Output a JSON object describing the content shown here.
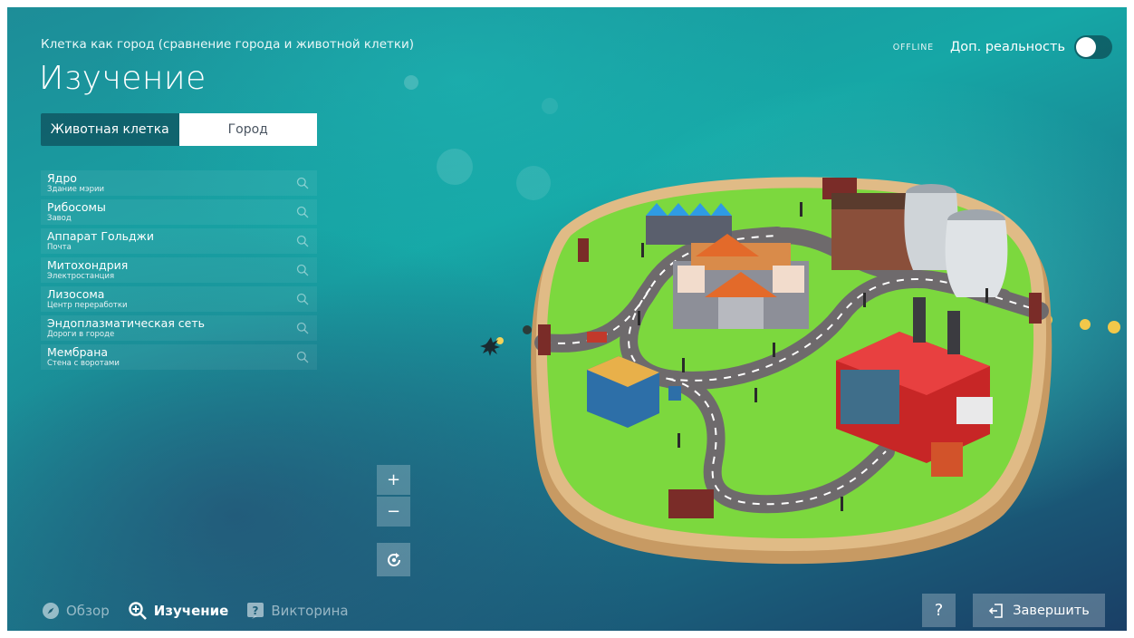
{
  "header": {
    "subtitle": "Клетка как город (сравнение города и животной клетки)",
    "title": "Изучение"
  },
  "ar": {
    "status": "OFFLINE",
    "label": "Доп. реальность",
    "enabled": false
  },
  "segmented": {
    "options": [
      "Животная клетка",
      "Город"
    ],
    "selected": "Город"
  },
  "organelles": [
    {
      "name": "Ядро",
      "analog": "Здание мэрии"
    },
    {
      "name": "Рибосомы",
      "analog": "Завод"
    },
    {
      "name": "Аппарат Гольджи",
      "analog": "Почта"
    },
    {
      "name": "Митохондрия",
      "analog": "Электростанция"
    },
    {
      "name": "Лизосома",
      "analog": "Центр переработки"
    },
    {
      "name": "Эндоплазматическая сеть",
      "analog": "Дороги в городе"
    },
    {
      "name": "Мембрана",
      "analog": "Стена с воротами"
    }
  ],
  "zoom": {
    "in": "+",
    "out": "−"
  },
  "nav": {
    "overview": "Обзор",
    "explore": "Изучение",
    "quiz": "Викторина",
    "active": "explore"
  },
  "help": "?",
  "finish_label": "Завершить",
  "icons": {
    "search": "magnifier-icon",
    "overview": "compass-icon",
    "explore": "zoom-plus-icon",
    "quiz": "question-square-icon",
    "reset": "reset-view-icon",
    "exit": "exit-door-icon"
  },
  "colors": {
    "background_teal": "#16a7a6",
    "background_navy": "#1a3f66",
    "grass": "#7cd83e",
    "road": "#6e6a6c",
    "wall": "#d9b07c",
    "factory_red": "#e12f2f"
  }
}
